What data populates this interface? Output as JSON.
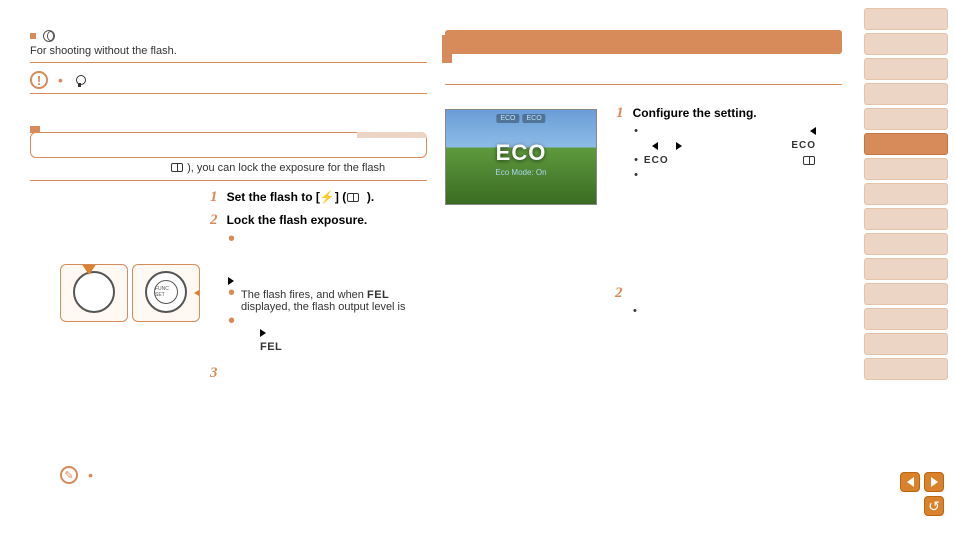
{
  "left": {
    "deactivating_text": "For shooting without the flash.",
    "fe_lead_tail": "), you can lock the exposure for the flash",
    "step1_label": "Set the flash to [",
    "step1_tail": "] (",
    "step1_close": ").",
    "step2_label": "Lock the flash exposure.",
    "flash_fires": "The flash fires, and when",
    "flash_fires_tail": "displayed, the flash output level is",
    "fel_text": "FEL",
    "fel_inline": "FEL",
    "step3_num": "3"
  },
  "right": {
    "configure": "Configure the setting.",
    "eco_label": "ECO",
    "eco_badge1": "ECO",
    "eco_badge2": "ECO",
    "eco_big": "ECO",
    "eco_sub": "Eco Mode: On",
    "step2_num": "2"
  },
  "flash_glyph": "⚡",
  "sidebar_tabs": 15,
  "active_tab_index": 5
}
